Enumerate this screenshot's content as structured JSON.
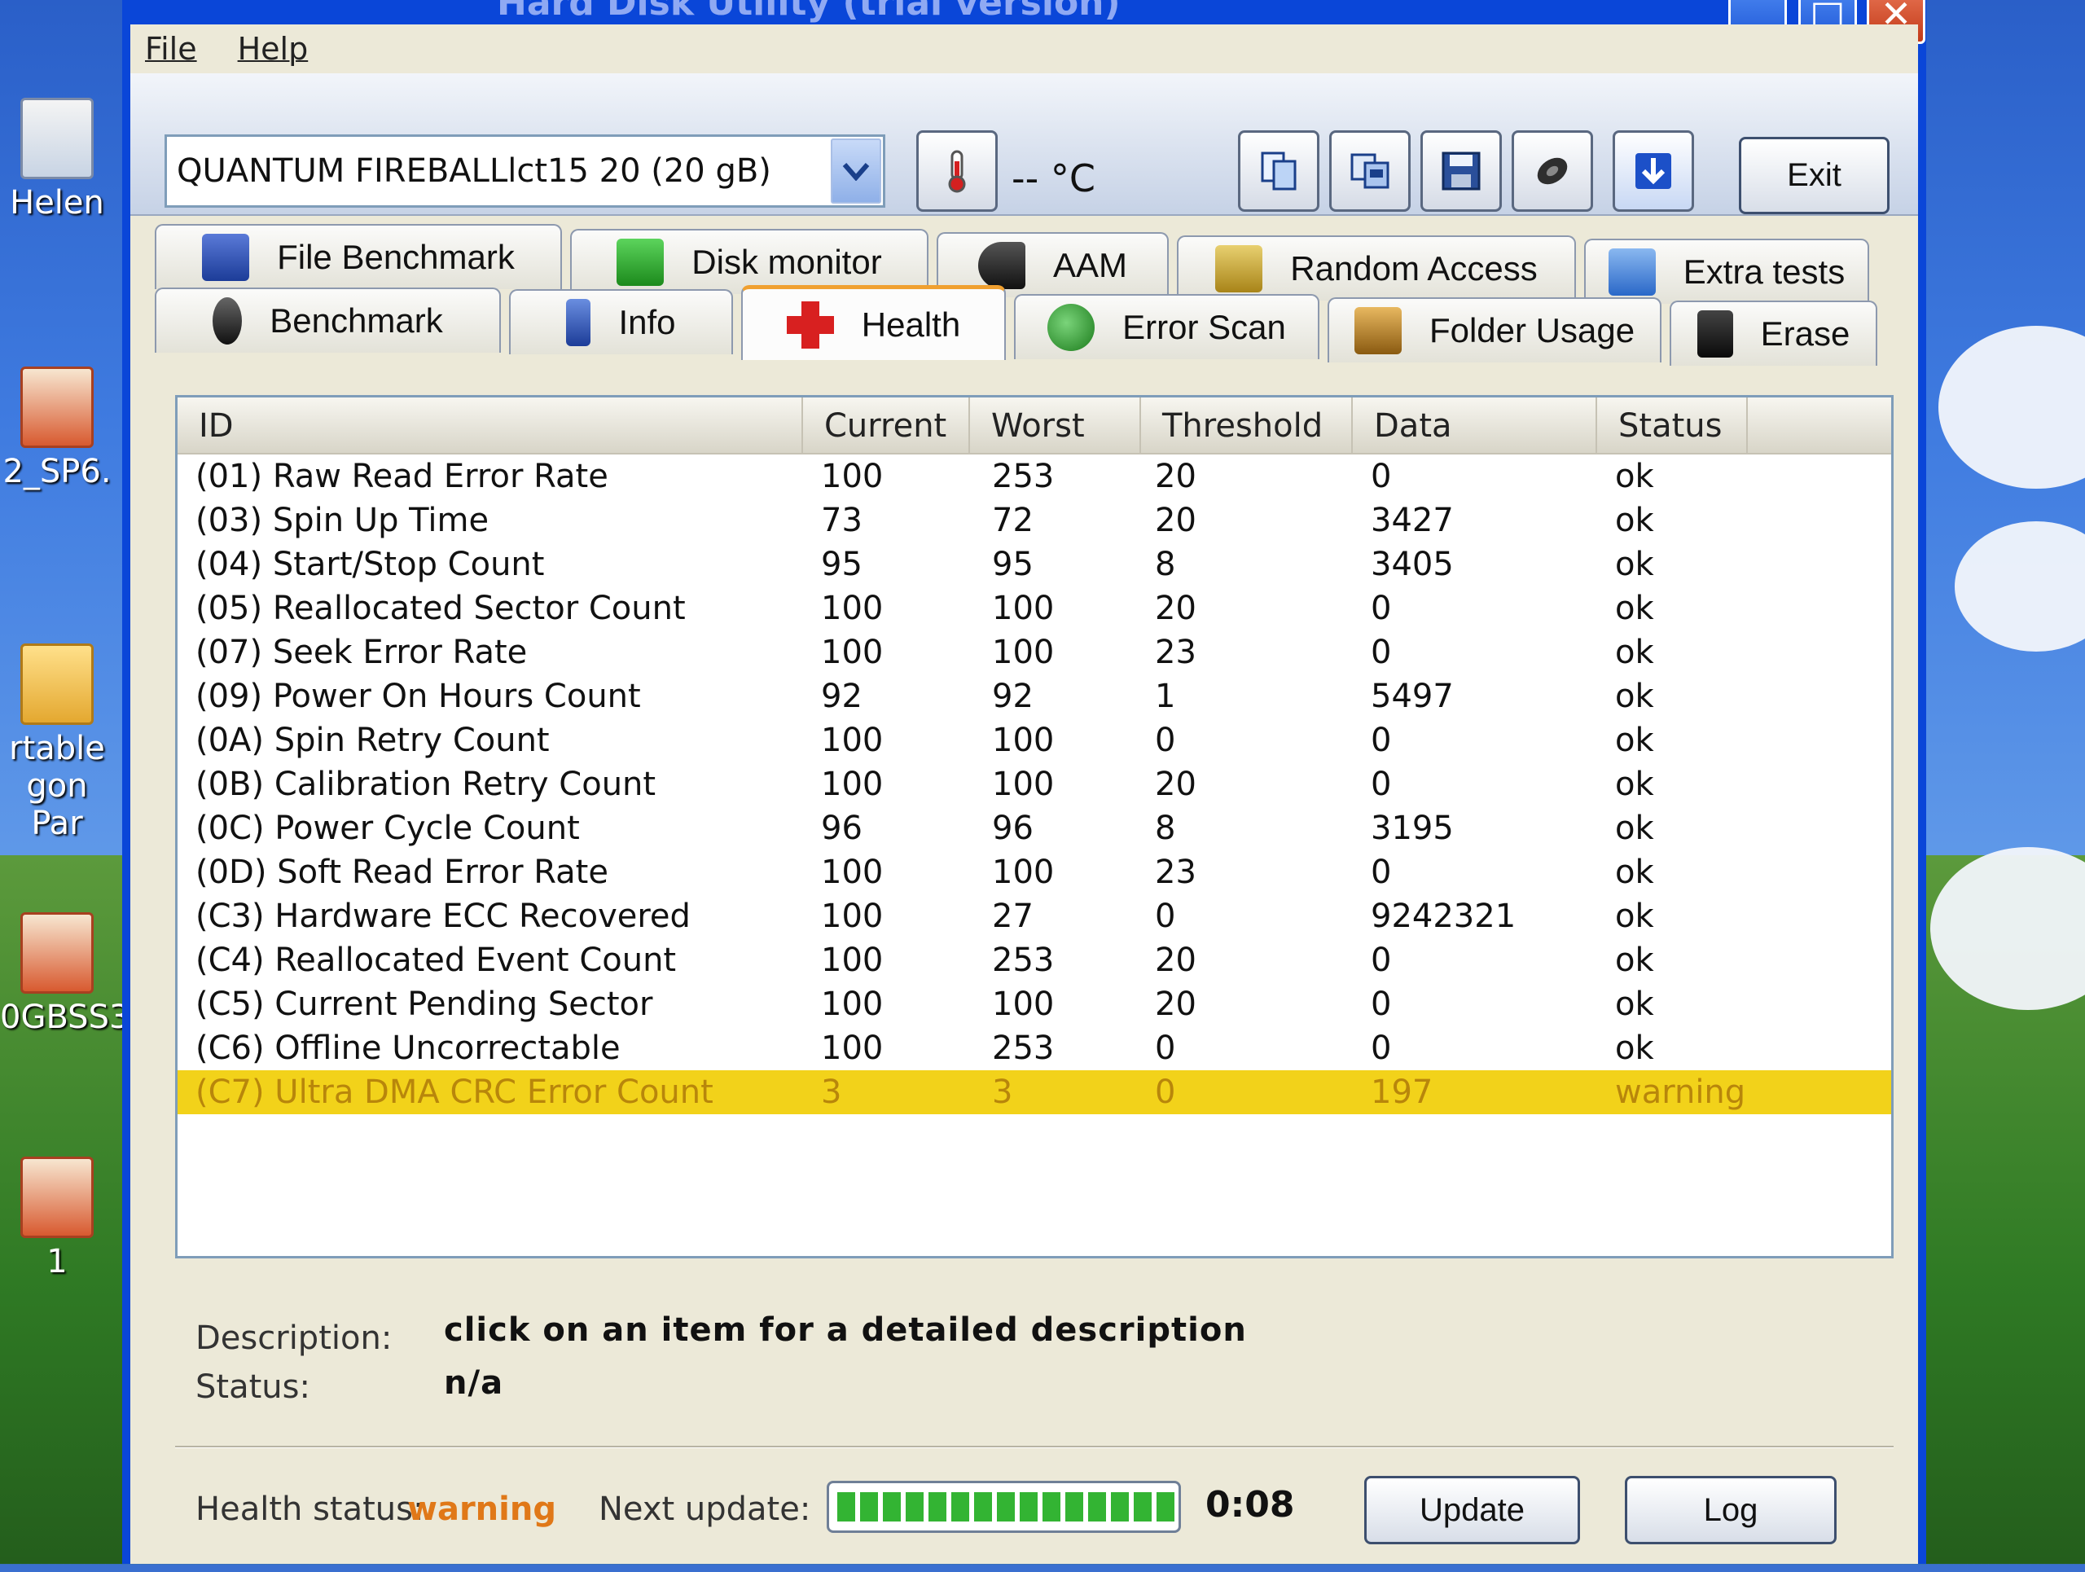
{
  "window": {
    "title": "Hard Disk Utility (trial version)",
    "controls": [
      "minimize",
      "maximize",
      "close"
    ]
  },
  "menu": [
    "File",
    "Help"
  ],
  "toolbar": {
    "drive": "QUANTUM FIREBALLlct15 20 (20 gB)",
    "temperature": "-- °C",
    "exit_label": "Exit",
    "buttons": [
      "copy-icon",
      "copy-screen-icon",
      "save-icon",
      "options-icon",
      "download-icon"
    ]
  },
  "tabs": {
    "row1": [
      "File Benchmark",
      "Disk monitor",
      "AAM",
      "Random Access",
      "Extra tests"
    ],
    "row2": [
      "Benchmark",
      "Info",
      "Health",
      "Error Scan",
      "Folder Usage",
      "Erase"
    ],
    "active": "Health"
  },
  "table": {
    "columns": [
      "ID",
      "Current",
      "Worst",
      "Threshold",
      "Data",
      "Status"
    ],
    "rows": [
      [
        "(01) Raw Read Error Rate",
        "100",
        "253",
        "20",
        "0",
        "ok"
      ],
      [
        "(03) Spin Up Time",
        "73",
        "72",
        "20",
        "3427",
        "ok"
      ],
      [
        "(04) Start/Stop Count",
        "95",
        "95",
        "8",
        "3405",
        "ok"
      ],
      [
        "(05) Reallocated Sector Count",
        "100",
        "100",
        "20",
        "0",
        "ok"
      ],
      [
        "(07) Seek Error Rate",
        "100",
        "100",
        "23",
        "0",
        "ok"
      ],
      [
        "(09) Power On Hours Count",
        "92",
        "92",
        "1",
        "5497",
        "ok"
      ],
      [
        "(0A) Spin Retry Count",
        "100",
        "100",
        "0",
        "0",
        "ok"
      ],
      [
        "(0B) Calibration Retry Count",
        "100",
        "100",
        "20",
        "0",
        "ok"
      ],
      [
        "(0C) Power Cycle Count",
        "96",
        "96",
        "8",
        "3195",
        "ok"
      ],
      [
        "(0D) Soft Read Error Rate",
        "100",
        "100",
        "23",
        "0",
        "ok"
      ],
      [
        "(C3) Hardware ECC Recovered",
        "100",
        "27",
        "0",
        "9242321",
        "ok"
      ],
      [
        "(C4) Reallocated Event Count",
        "100",
        "253",
        "20",
        "0",
        "ok"
      ],
      [
        "(C5) Current Pending Sector",
        "100",
        "100",
        "20",
        "0",
        "ok"
      ],
      [
        "(C6) Offline Uncorrectable",
        "100",
        "253",
        "0",
        "0",
        "ok"
      ],
      [
        "(C7) Ultra DMA CRC Error Count",
        "3",
        "3",
        "0",
        "197",
        "warning"
      ]
    ],
    "highlight_color": "#f2d21a"
  },
  "description": {
    "description_label": "Description:",
    "description_value": "click on an item for a detailed description",
    "status_label": "Status:",
    "status_value": "n/a"
  },
  "footer": {
    "health_label": "Health status:",
    "health_value": "warning",
    "next_update_label": "Next update:",
    "progress_fraction": 1.0,
    "countdown": "0:08",
    "update_label": "Update",
    "log_label": "Log"
  },
  "desktop": {
    "icons": [
      "Helen",
      "2_SP6.",
      "rtable",
      "gon Par",
      "0GBSS3",
      "1"
    ]
  }
}
